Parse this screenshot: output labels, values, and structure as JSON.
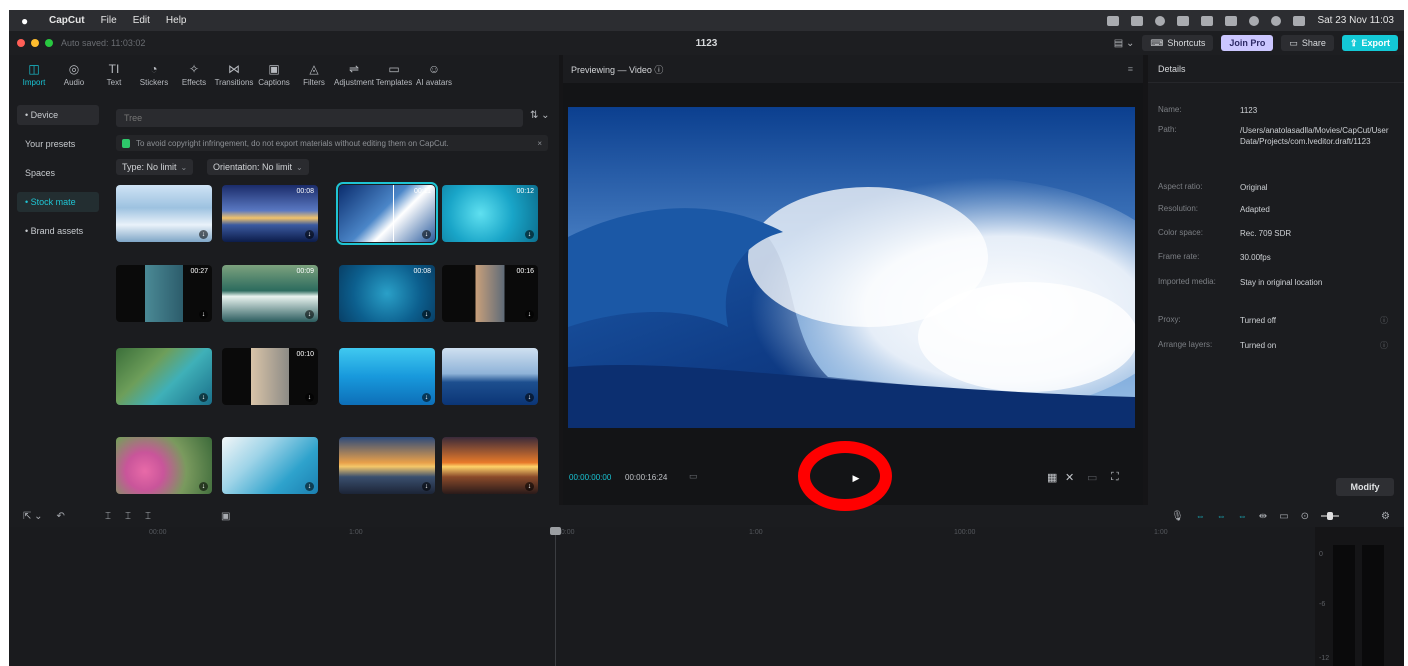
{
  "menubar": {
    "app": "CapCut",
    "items": [
      "File",
      "Edit",
      "Help"
    ],
    "datetime": "Sat 23 Nov 11:03"
  },
  "titlebar": {
    "autosave": "Auto saved: 11:03:02",
    "project": "1123",
    "shortcuts": "Shortcuts",
    "join_pro": "Join Pro",
    "share": "Share",
    "export": "Export"
  },
  "toolbar": {
    "tools": [
      {
        "label": "Import",
        "icon": "import-icon"
      },
      {
        "label": "Audio",
        "icon": "audio-icon"
      },
      {
        "label": "Text",
        "icon": "text-icon"
      },
      {
        "label": "Stickers",
        "icon": "stickers-icon"
      },
      {
        "label": "Effects",
        "icon": "effects-icon"
      },
      {
        "label": "Transitions",
        "icon": "transitions-icon"
      },
      {
        "label": "Captions",
        "icon": "captions-icon"
      },
      {
        "label": "Filters",
        "icon": "filters-icon"
      },
      {
        "label": "Adjustment",
        "icon": "adjustment-icon"
      },
      {
        "label": "Templates",
        "icon": "templates-icon"
      },
      {
        "label": "AI avatars",
        "icon": "ai-avatars-icon"
      }
    ]
  },
  "subnav": {
    "items": [
      "• Device",
      "Your presets",
      "Spaces",
      "• Stock mate",
      "• Brand assets"
    ]
  },
  "library": {
    "search_placeholder": "Tree",
    "notice": "To avoid copyright infringement, do not export materials without editing them on CapCut.",
    "type_filter": "Type: No limit",
    "orientation_filter": "Orientation: No limit",
    "durations": [
      "",
      "00:08",
      "00:11",
      "00:12",
      "00:27",
      "00:09",
      "00:08",
      "00:16",
      "",
      "00:10",
      "",
      "",
      "",
      "",
      "",
      ""
    ]
  },
  "preview": {
    "header": "Previewing — Video ⓘ",
    "time_current": "00:00:00:00",
    "time_total": "00:00:16:24"
  },
  "details": {
    "title": "Details",
    "rows": [
      {
        "k": "Name:",
        "v": "1123"
      },
      {
        "k": "Path:",
        "v": "/Users/anatolasadlla/Movies/CapCut/User Data/Projects/com.lveditor.draft/1123"
      },
      {
        "k": "Aspect ratio:",
        "v": "Original"
      },
      {
        "k": "Resolution:",
        "v": "Adapted"
      },
      {
        "k": "Color space:",
        "v": "Rec. 709 SDR"
      },
      {
        "k": "Frame rate:",
        "v": "30.00fps"
      },
      {
        "k": "Imported media:",
        "v": "Stay in original location"
      },
      {
        "k": "Proxy:",
        "v": "Turned off"
      },
      {
        "k": "Arrange layers:",
        "v": "Turned on"
      }
    ],
    "modify": "Modify"
  },
  "timeline": {
    "ruler": [
      "00:00",
      "1:00",
      "00:00",
      "1:00",
      "100:00",
      "1:00"
    ],
    "meter_labels": [
      "0",
      "-6",
      "-12"
    ]
  },
  "colors": {
    "accent": "#19c3d3",
    "annotation": "#ff0000"
  }
}
